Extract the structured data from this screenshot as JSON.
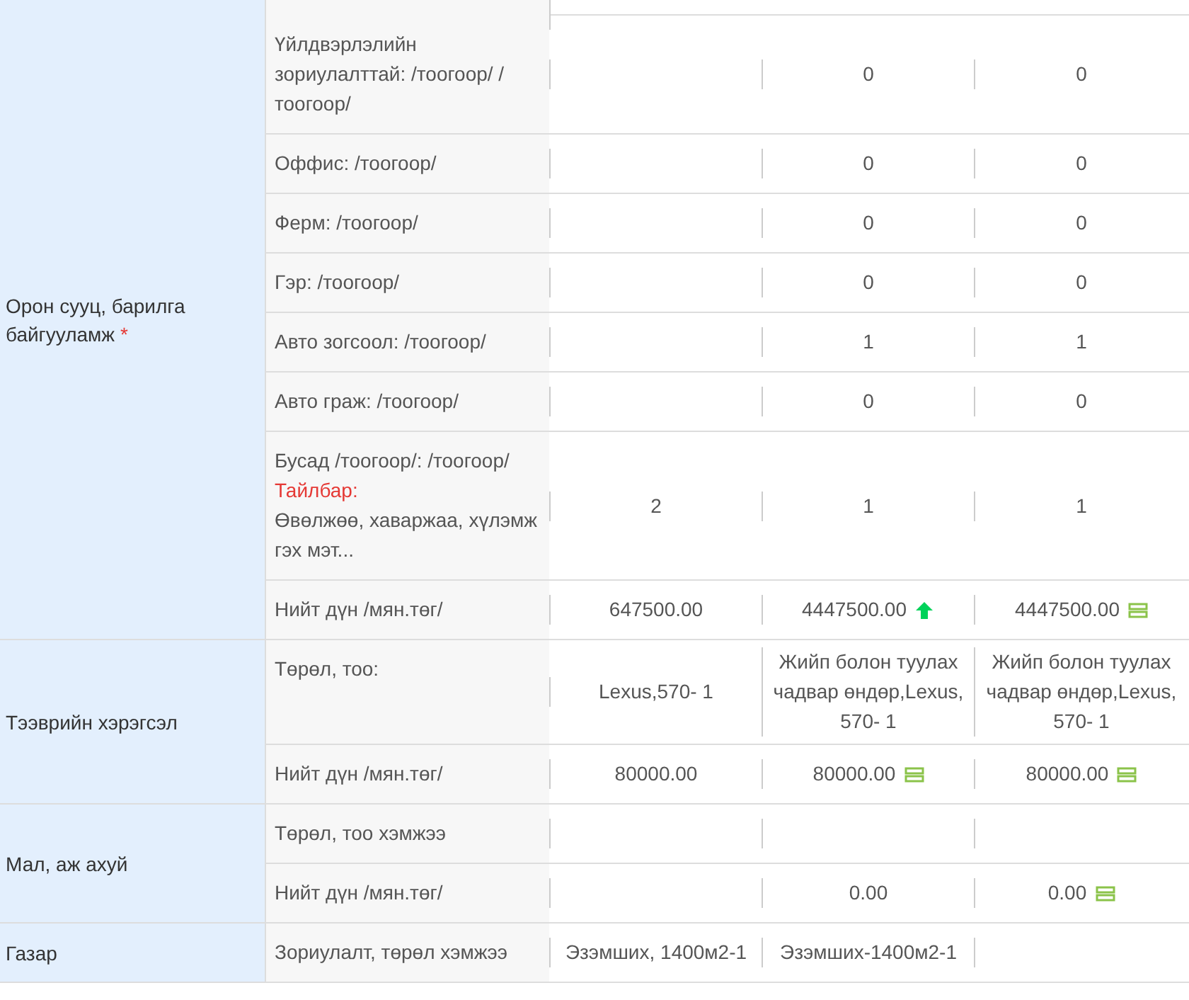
{
  "sections": [
    {
      "category": "Орон сууц, барилга байгууламж",
      "required_mark": "*",
      "rows": [
        {
          "label": "Үйлдвэрлэлийн зориулалттай: /тоогоор/ /тоогоор/",
          "values": [
            {
              "kind": "blank"
            },
            {
              "kind": "text",
              "text": "0"
            },
            {
              "kind": "text",
              "text": "0"
            }
          ]
        },
        {
          "label": "Оффис: /тоогоор/",
          "values": [
            {
              "kind": "blank"
            },
            {
              "kind": "text",
              "text": "0"
            },
            {
              "kind": "text",
              "text": "0"
            }
          ]
        },
        {
          "label": "Ферм: /тоогоор/",
          "values": [
            {
              "kind": "blank"
            },
            {
              "kind": "text",
              "text": "0"
            },
            {
              "kind": "text",
              "text": "0"
            }
          ]
        },
        {
          "label": "Гэр: /тоогоор/",
          "values": [
            {
              "kind": "blank"
            },
            {
              "kind": "text",
              "text": "0"
            },
            {
              "kind": "text",
              "text": "0"
            }
          ]
        },
        {
          "label": "Авто зогсоол: /тоогоор/",
          "values": [
            {
              "kind": "blank"
            },
            {
              "kind": "text",
              "text": "1"
            },
            {
              "kind": "text",
              "text": "1"
            }
          ]
        },
        {
          "label": "Авто граж: /тоогоор/",
          "values": [
            {
              "kind": "blank"
            },
            {
              "kind": "text",
              "text": "0"
            },
            {
              "kind": "text",
              "text": "0"
            }
          ]
        },
        {
          "label": "Бусад /тоогоор/: /тоогоор/",
          "note_label": "Тайлбар:",
          "note": "Өвөлжөө, хаваржаа, хүлэмж гэх мэт...",
          "values": [
            {
              "kind": "text",
              "text": "2"
            },
            {
              "kind": "text",
              "text": "1"
            },
            {
              "kind": "text",
              "text": "1"
            }
          ]
        },
        {
          "label": "Нийт дүн /мян.төг/",
          "values": [
            {
              "kind": "text",
              "text": "647500.00"
            },
            {
              "kind": "rising",
              "text": "4447500.00"
            },
            {
              "kind": "unchanged",
              "text": "4447500.00"
            }
          ]
        }
      ]
    },
    {
      "category": "Тээврийн хэрэгсэл",
      "rows": [
        {
          "label": "Төрөл, тоо:",
          "values": [
            {
              "kind": "text",
              "text": "Lexus,570- 1"
            },
            {
              "kind": "text",
              "text": "Жийп болон туулах чадвар өндөр,Lexus, 570- 1"
            },
            {
              "kind": "text",
              "text": "Жийп болон туулах чадвар өндөр,Lexus, 570- 1"
            }
          ]
        },
        {
          "label": "Нийт дүн /мян.төг/",
          "values": [
            {
              "kind": "text",
              "text": "80000.00"
            },
            {
              "kind": "unchanged",
              "text": "80000.00"
            },
            {
              "kind": "unchanged",
              "text": "80000.00"
            }
          ]
        }
      ]
    },
    {
      "category": "Мал, аж ахуй",
      "rows": [
        {
          "label": "Төрөл, тоо хэмжээ",
          "values": [
            {
              "kind": "blank"
            },
            {
              "kind": "blank"
            },
            {
              "kind": "blank"
            }
          ]
        },
        {
          "label": "Нийт дүн /мян.төг/",
          "values": [
            {
              "kind": "blank"
            },
            {
              "kind": "text",
              "text": "0.00"
            },
            {
              "kind": "unchanged",
              "text": "0.00"
            }
          ]
        }
      ]
    },
    {
      "category": "Газар",
      "rows": [
        {
          "label": "Зориулалт, төрөл хэмжээ",
          "values": [
            {
              "kind": "text",
              "text": "Эзэмших, 1400м2-1"
            },
            {
              "kind": "text",
              "text": "Эзэмших-1400м2-1"
            },
            {
              "kind": "blank"
            }
          ]
        }
      ]
    }
  ]
}
